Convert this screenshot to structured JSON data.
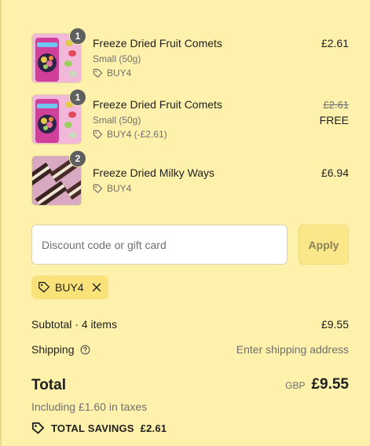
{
  "items": [
    {
      "name": "Freeze Dried Fruit Comets",
      "variant": "Small (50g)",
      "discount": "BUY4",
      "price": "£2.61",
      "quantity": "1",
      "image_icon": "fruit-comets-product-image"
    },
    {
      "name": "Freeze Dried Fruit Comets",
      "variant": "Small (50g)",
      "discount": "BUY4 (-£2.61)",
      "original_price": "£2.61",
      "price": "FREE",
      "quantity": "1",
      "image_icon": "fruit-comets-product-image"
    },
    {
      "name": "Freeze Dried Milky Ways",
      "discount": "BUY4",
      "price": "£6.94",
      "quantity": "2",
      "image_icon": "milky-ways-product-image"
    }
  ],
  "discount_form": {
    "placeholder": "Discount code or gift card",
    "value": "",
    "apply_label": "Apply"
  },
  "applied_code": "BUY4",
  "summary": {
    "subtotal_label": "Subtotal · 4 items",
    "subtotal_value": "£9.55",
    "shipping_label": "Shipping",
    "shipping_value": "Enter shipping address",
    "total_label": "Total",
    "currency": "GBP",
    "total_value": "£9.55",
    "taxes": "Including £1.60 in taxes",
    "savings_label": "TOTAL SAVINGS",
    "savings_value": "£2.61"
  },
  "colors": {
    "background": "#fdf1ac",
    "chip": "#fae27a",
    "apply_button": "#fae78a"
  }
}
